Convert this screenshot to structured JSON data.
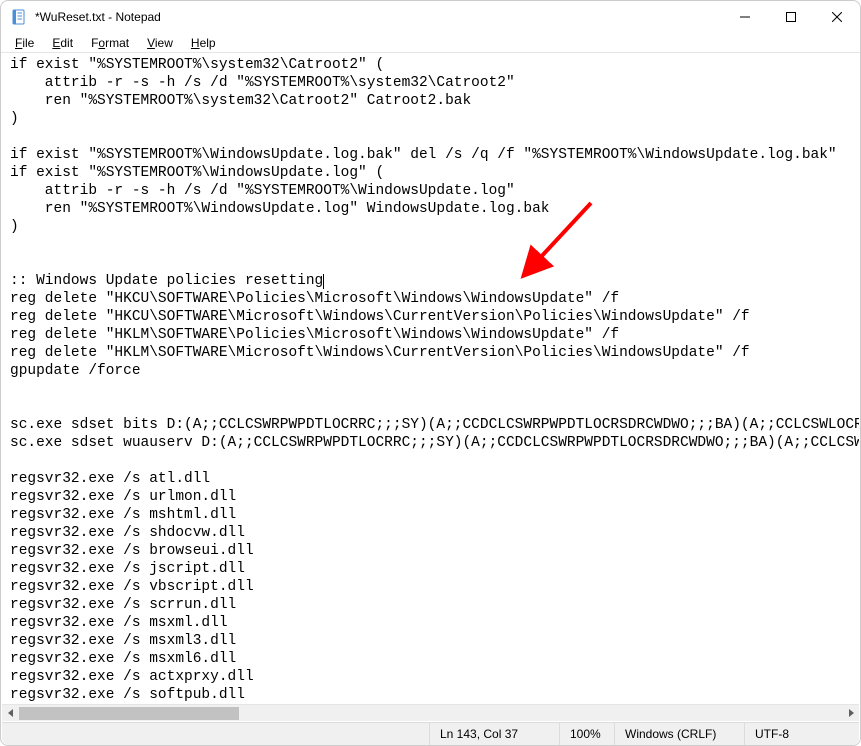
{
  "window": {
    "title": "*WuReset.txt - Notepad"
  },
  "menu": {
    "file": "File",
    "edit": "Edit",
    "format": "Format",
    "view": "View",
    "help": "Help"
  },
  "editor": {
    "lines": [
      "if exist \"%SYSTEMROOT%\\system32\\Catroot2\" (",
      "    attrib -r -s -h /s /d \"%SYSTEMROOT%\\system32\\Catroot2\"",
      "    ren \"%SYSTEMROOT%\\system32\\Catroot2\" Catroot2.bak",
      ")",
      "",
      "if exist \"%SYSTEMROOT%\\WindowsUpdate.log.bak\" del /s /q /f \"%SYSTEMROOT%\\WindowsUpdate.log.bak\"",
      "if exist \"%SYSTEMROOT%\\WindowsUpdate.log\" (",
      "    attrib -r -s -h /s /d \"%SYSTEMROOT%\\WindowsUpdate.log\"",
      "    ren \"%SYSTEMROOT%\\WindowsUpdate.log\" WindowsUpdate.log.bak",
      ")",
      "",
      "",
      ":: Windows Update policies resetting",
      "reg delete \"HKCU\\SOFTWARE\\Policies\\Microsoft\\Windows\\WindowsUpdate\" /f",
      "reg delete \"HKCU\\SOFTWARE\\Microsoft\\Windows\\CurrentVersion\\Policies\\WindowsUpdate\" /f",
      "reg delete \"HKLM\\SOFTWARE\\Policies\\Microsoft\\Windows\\WindowsUpdate\" /f",
      "reg delete \"HKLM\\SOFTWARE\\Microsoft\\Windows\\CurrentVersion\\Policies\\WindowsUpdate\" /f",
      "gpupdate /force",
      "",
      "",
      "sc.exe sdset bits D:(A;;CCLCSWRPWPDTLOCRRC;;;SY)(A;;CCDCLCSWRPWPDTLOCRSDRCWDWO;;;BA)(A;;CCLCSWLOCRRC;;;AU",
      "sc.exe sdset wuauserv D:(A;;CCLCSWRPWPDTLOCRRC;;;SY)(A;;CCDCLCSWRPWPDTLOCRSDRCWDWO;;;BA)(A;;CCLCSWLOCRRC",
      "",
      "regsvr32.exe /s atl.dll",
      "regsvr32.exe /s urlmon.dll",
      "regsvr32.exe /s mshtml.dll",
      "regsvr32.exe /s shdocvw.dll",
      "regsvr32.exe /s browseui.dll",
      "regsvr32.exe /s jscript.dll",
      "regsvr32.exe /s vbscript.dll",
      "regsvr32.exe /s scrrun.dll",
      "regsvr32.exe /s msxml.dll",
      "regsvr32.exe /s msxml3.dll",
      "regsvr32.exe /s msxml6.dll",
      "regsvr32.exe /s actxprxy.dll",
      "regsvr32.exe /s softpub.dll"
    ],
    "caret_line_index": 12
  },
  "status": {
    "position": "Ln 143, Col 37",
    "zoom": "100%",
    "eol": "Windows (CRLF)",
    "encoding": "UTF-8"
  },
  "annotation": {
    "arrow_color": "#ff0000"
  }
}
